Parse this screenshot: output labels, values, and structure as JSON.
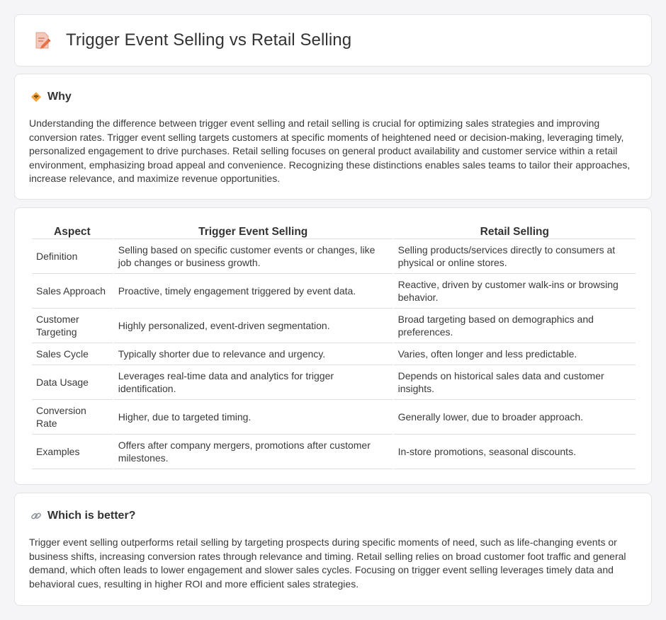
{
  "header": {
    "title": "Trigger Event Selling vs Retail Selling",
    "icon": "document-pencil-icon"
  },
  "why": {
    "title": "Why",
    "icon": "warning-diamond-icon",
    "text": "Understanding the difference between trigger event selling and retail selling is crucial for optimizing sales strategies and improving conversion rates. Trigger event selling targets customers at specific moments of heightened need or decision-making, leveraging timely, personalized engagement to drive purchases. Retail selling focuses on general product availability and customer service within a retail environment, emphasizing broad appeal and convenience. Recognizing these distinctions enables sales teams to tailor their approaches, increase relevance, and maximize revenue opportunities."
  },
  "table": {
    "headers": [
      "Aspect",
      "Trigger Event Selling",
      "Retail Selling"
    ],
    "rows": [
      [
        "Definition",
        "Selling based on specific customer events or changes, like job changes or business growth.",
        "Selling products/services directly to consumers at physical or online stores."
      ],
      [
        "Sales Approach",
        "Proactive, timely engagement triggered by event data.",
        "Reactive, driven by customer walk-ins or browsing behavior."
      ],
      [
        "Customer Targeting",
        "Highly personalized, event-driven segmentation.",
        "Broad targeting based on demographics and preferences."
      ],
      [
        "Sales Cycle",
        "Typically shorter due to relevance and urgency.",
        "Varies, often longer and less predictable."
      ],
      [
        "Data Usage",
        "Leverages real-time data and analytics for trigger identification.",
        "Depends on historical sales data and customer insights."
      ],
      [
        "Conversion Rate",
        "Higher, due to targeted timing.",
        "Generally lower, due to broader approach."
      ],
      [
        "Examples",
        "Offers after company mergers, promotions after customer milestones.",
        "In-store promotions, seasonal discounts."
      ]
    ]
  },
  "better": {
    "title": "Which is better?",
    "icon": "link-icon",
    "text": "Trigger event selling outperforms retail selling by targeting prospects during specific moments of need, such as life-changing events or business shifts, increasing conversion rates through relevance and timing. Retail selling relies on broad customer foot traffic and general demand, which often leads to lower engagement and slower sales cycles. Focusing on trigger event selling leverages timely data and behavioral cues, resulting in higher ROI and more efficient sales strategies."
  },
  "colors": {
    "accent": "#e8734a",
    "border": "#e4e4e8",
    "background": "#f5f5f7"
  }
}
